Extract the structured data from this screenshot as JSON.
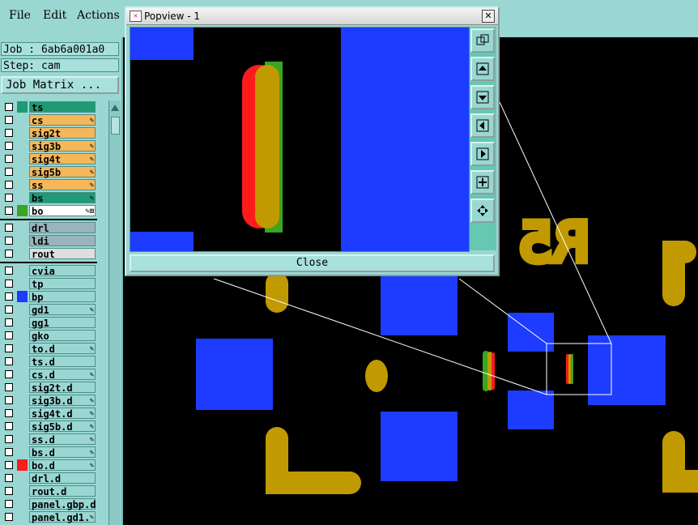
{
  "menu": {
    "file": "File",
    "edit": "Edit",
    "actions": "Actions"
  },
  "job": {
    "job_label": "Job : 6ab6a001a0",
    "step_label": "Step: cam",
    "matrix_button": "Job Matrix ..."
  },
  "layers": [
    {
      "name": "ts",
      "color": "#1f9a74",
      "label_bg": "#1f9a74",
      "mark": ""
    },
    {
      "name": "cs",
      "color": "",
      "label_bg": "#f5b75a",
      "mark": "✎"
    },
    {
      "name": "sig2t",
      "color": "",
      "label_bg": "#f5b75a",
      "mark": ""
    },
    {
      "name": "sig3b",
      "color": "",
      "label_bg": "#f5b75a",
      "mark": "✎"
    },
    {
      "name": "sig4t",
      "color": "",
      "label_bg": "#f5b75a",
      "mark": "✎"
    },
    {
      "name": "sig5b",
      "color": "",
      "label_bg": "#f5b75a",
      "mark": "✎"
    },
    {
      "name": "ss",
      "color": "",
      "label_bg": "#f5b75a",
      "mark": "✎"
    },
    {
      "name": "bs",
      "color": "",
      "label_bg": "#1f9a74",
      "mark": "✎"
    },
    {
      "name": "bo",
      "color": "#3aa520",
      "label_bg": "#ffffff",
      "mark": "✎⊞"
    },
    {
      "name": "drl",
      "color": "",
      "label_bg": "#9ab4bc",
      "mark": ""
    },
    {
      "name": "ldi",
      "color": "",
      "label_bg": "#9ab4bc",
      "mark": ""
    },
    {
      "name": "rout",
      "color": "",
      "label_bg": "#dedede",
      "mark": ""
    },
    {
      "name": "cvia",
      "color": "",
      "label_bg": "#9ad7d3",
      "mark": ""
    },
    {
      "name": "tp",
      "color": "",
      "label_bg": "#9ad7d3",
      "mark": ""
    },
    {
      "name": "bp",
      "color": "#1d3cff",
      "label_bg": "#9ad7d3",
      "mark": ""
    },
    {
      "name": "gd1",
      "color": "",
      "label_bg": "#9ad7d3",
      "mark": "✎"
    },
    {
      "name": "gg1",
      "color": "",
      "label_bg": "#9ad7d3",
      "mark": ""
    },
    {
      "name": "gko",
      "color": "",
      "label_bg": "#9ad7d3",
      "mark": ""
    },
    {
      "name": "to.d",
      "color": "",
      "label_bg": "#9ad7d3",
      "mark": "✎"
    },
    {
      "name": "ts.d",
      "color": "",
      "label_bg": "#9ad7d3",
      "mark": ""
    },
    {
      "name": "cs.d",
      "color": "",
      "label_bg": "#9ad7d3",
      "mark": "✎"
    },
    {
      "name": "sig2t.d",
      "color": "",
      "label_bg": "#9ad7d3",
      "mark": ""
    },
    {
      "name": "sig3b.d",
      "color": "",
      "label_bg": "#9ad7d3",
      "mark": "✎"
    },
    {
      "name": "sig4t.d",
      "color": "",
      "label_bg": "#9ad7d3",
      "mark": "✎"
    },
    {
      "name": "sig5b.d",
      "color": "",
      "label_bg": "#9ad7d3",
      "mark": "✎"
    },
    {
      "name": "ss.d",
      "color": "",
      "label_bg": "#9ad7d3",
      "mark": "✎"
    },
    {
      "name": "bs.d",
      "color": "",
      "label_bg": "#9ad7d3",
      "mark": "✎"
    },
    {
      "name": "bo.d",
      "color": "#ff1b1b",
      "label_bg": "#9ad7d3",
      "mark": "✎"
    },
    {
      "name": "drl.d",
      "color": "",
      "label_bg": "#9ad7d3",
      "mark": ""
    },
    {
      "name": "rout.d",
      "color": "",
      "label_bg": "#9ad7d3",
      "mark": ""
    },
    {
      "name": "panel.gbp.d",
      "color": "",
      "label_bg": "#9ad7d3",
      "mark": ""
    },
    {
      "name": "panel.gd1.",
      "color": "",
      "label_bg": "#9ad7d3",
      "mark": "✎"
    }
  ],
  "popview": {
    "title": "Popview - 1",
    "close_label": "Close"
  },
  "canvas": {
    "silkscreen_text": "R5",
    "colors": {
      "pad": "#1d3cff",
      "silk": "#c09a00",
      "top": "#ff1b1b",
      "bottom": "#3aa520"
    }
  },
  "tools": [
    "zoom-extents-icon",
    "pan-up-icon",
    "pan-down-icon",
    "pan-left-icon",
    "pan-right-icon",
    "zoom-in-icon",
    "zoom-out-icon"
  ]
}
